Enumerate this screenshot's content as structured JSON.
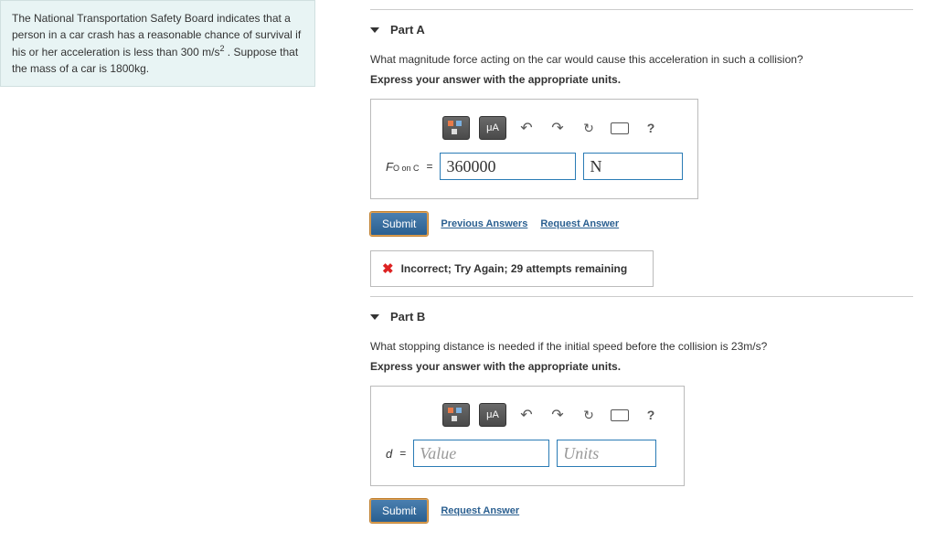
{
  "problem": {
    "statement_html": "The National Transportation Safety Board indicates that a person in a car crash has a reasonable chance of survival if his or her acceleration is less than 300 m/s² . Suppose that the mass of a car is 1800kg."
  },
  "partA": {
    "title": "Part A",
    "question": "What magnitude force acting on the car would cause this acceleration in such a collision?",
    "instruction": "Express your answer with the appropriate units.",
    "var_label": "F",
    "var_sub": "O on C",
    "equals": "=",
    "value": "360000",
    "units": "N",
    "toolbar": {
      "units_btn": "μA",
      "help": "?"
    },
    "submit": "Submit",
    "prev_answers": "Previous Answers",
    "request_answer": "Request Answer",
    "feedback": "Incorrect; Try Again; 29 attempts remaining"
  },
  "partB": {
    "title": "Part B",
    "question": "What stopping distance is needed if the initial speed before the collision is 23m/s?",
    "instruction": "Express your answer with the appropriate units.",
    "var_label": "d",
    "equals": "=",
    "value_placeholder": "Value",
    "units_placeholder": "Units",
    "toolbar": {
      "units_btn": "μA",
      "help": "?"
    },
    "submit": "Submit",
    "request_answer": "Request Answer"
  }
}
